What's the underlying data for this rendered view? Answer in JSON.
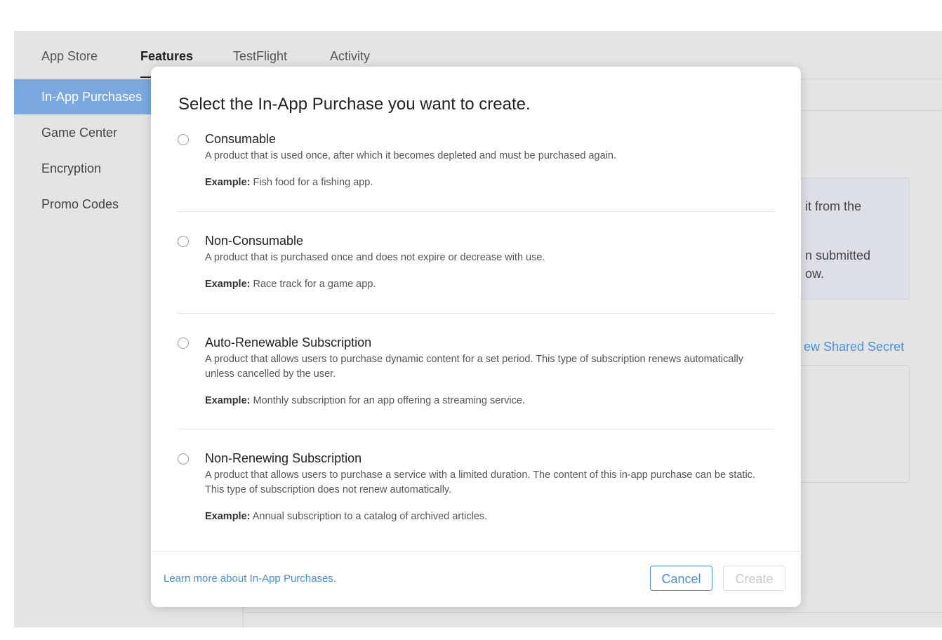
{
  "tabs": [
    {
      "label": "App Store"
    },
    {
      "label": "Features"
    },
    {
      "label": "TestFlight"
    },
    {
      "label": "Activity"
    }
  ],
  "sidebar": {
    "items": [
      {
        "label": "In-App Purchases"
      },
      {
        "label": "Game Center"
      },
      {
        "label": "Encryption"
      },
      {
        "label": "Promo Codes"
      }
    ]
  },
  "background_content": {
    "info_line_1": "it from the",
    "info_line_2": "n submitted",
    "info_line_3": "ow.",
    "shared_secret_link": "ew Shared Secret"
  },
  "modal": {
    "title": "Select the In-App Purchase you want to create.",
    "example_label": "Example:",
    "options": [
      {
        "title": "Consumable",
        "description": "A product that is used once, after which it becomes depleted and must be purchased again.",
        "example": "Fish food for a fishing app."
      },
      {
        "title": "Non-Consumable",
        "description": "A product that is purchased once and does not expire or decrease with use.",
        "example": "Race track for a game app."
      },
      {
        "title": "Auto-Renewable Subscription",
        "description": "A product that allows users to purchase dynamic content for a set period. This type of subscription renews automatically unless cancelled by the user.",
        "example": "Monthly subscription for an app offering a streaming service."
      },
      {
        "title": "Non-Renewing Subscription",
        "description": "A product that allows users to purchase a service with a limited duration. The content of this in-app purchase can be static. This type of subscription does not renew automatically.",
        "example": "Annual subscription to a catalog of archived articles."
      }
    ],
    "footer": {
      "learn_more": "Learn more about In-App Purchases.",
      "cancel_label": "Cancel",
      "create_label": "Create"
    }
  },
  "colors": {
    "accent": "#4a90d9",
    "sidebar_selected": "#7aa9e0",
    "background": "#e4e4e4"
  }
}
